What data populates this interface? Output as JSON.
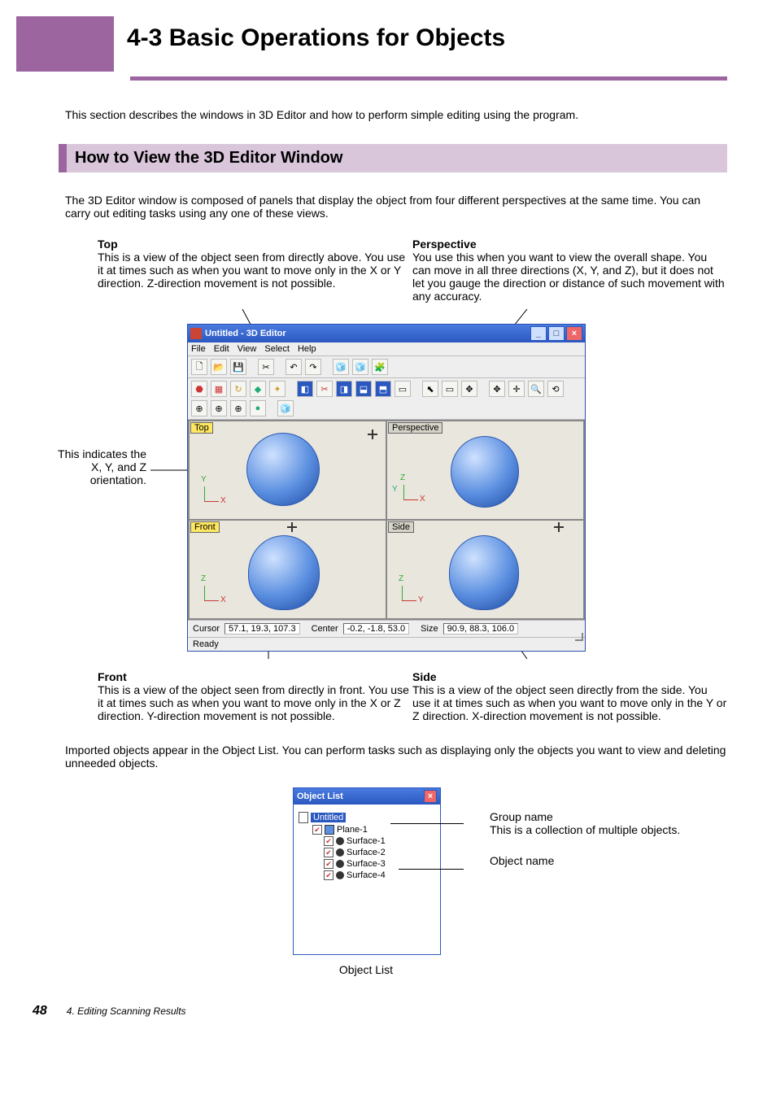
{
  "chapter_title": "4-3 Basic Operations for Objects",
  "intro": "This section describes the windows in 3D Editor and how to perform simple editing using the program.",
  "section_title": "How to View the 3D Editor Window",
  "section_body": "The 3D Editor window is composed of panels that display the object from four different perspectives at the same time. You can carry out editing tasks using any one of these views.",
  "views": {
    "top": {
      "label": "Top",
      "text": "This is a view of the object seen from directly above. You use it at times such as when you want to move only in the X or Y direction. Z-direction movement is not possible."
    },
    "perspective": {
      "label": "Perspective",
      "text": "You use this when you want to view the overall shape. You can move in all three directions (X, Y, and Z), but it does not let you gauge the direction or distance of such movement with any accuracy."
    },
    "front": {
      "label": "Front",
      "text": "This is a view of the object seen from directly in front. You use it at times such as when you want to move only in the X or Z direction. Y-direction movement is not possible."
    },
    "side": {
      "label": "Side",
      "text": "This is a view of the object seen directly from the side. You use it at times such as when you want to move only in the Y or Z direction. X-direction movement is not possible."
    }
  },
  "axis_note": "This indicates the X, Y, and Z orientation.",
  "editor": {
    "title": "Untitled - 3D Editor",
    "menu": [
      "File",
      "Edit",
      "View",
      "Select",
      "Help"
    ],
    "viewport_labels": {
      "top": "Top",
      "perspective": "Perspective",
      "front": "Front",
      "side": "Side"
    },
    "axes": {
      "top": {
        "h": "X",
        "v": "Y"
      },
      "perspective": {
        "h": "X",
        "v": "Z",
        "extra": "Y"
      },
      "front": {
        "h": "X",
        "v": "Z"
      },
      "side": {
        "h": "Y",
        "v": "Z"
      }
    },
    "status": {
      "cursor_label": "Cursor",
      "cursor_value": "57.1, 19.3, 107.3",
      "center_label": "Center",
      "center_value": "-0.2, -1.8, 53.0",
      "size_label": "Size",
      "size_value": "90.9, 88.3, 106.0"
    },
    "ready": "Ready"
  },
  "objlist_intro": "Imported objects appear in the Object List. You can perform tasks such as displaying only the objects you want to view and deleting unneeded objects.",
  "objlist": {
    "title": "Object List",
    "root": "Untitled",
    "group": "Plane-1",
    "items": [
      "Surface-1",
      "Surface-2",
      "Surface-3",
      "Surface-4"
    ],
    "caption": "Object List",
    "group_annot_title": "Group name",
    "group_annot_text": "This is a collection of multiple objects.",
    "object_annot_title": "Object name"
  },
  "footer": {
    "page": "48",
    "chapter": "4. Editing Scanning Results"
  }
}
